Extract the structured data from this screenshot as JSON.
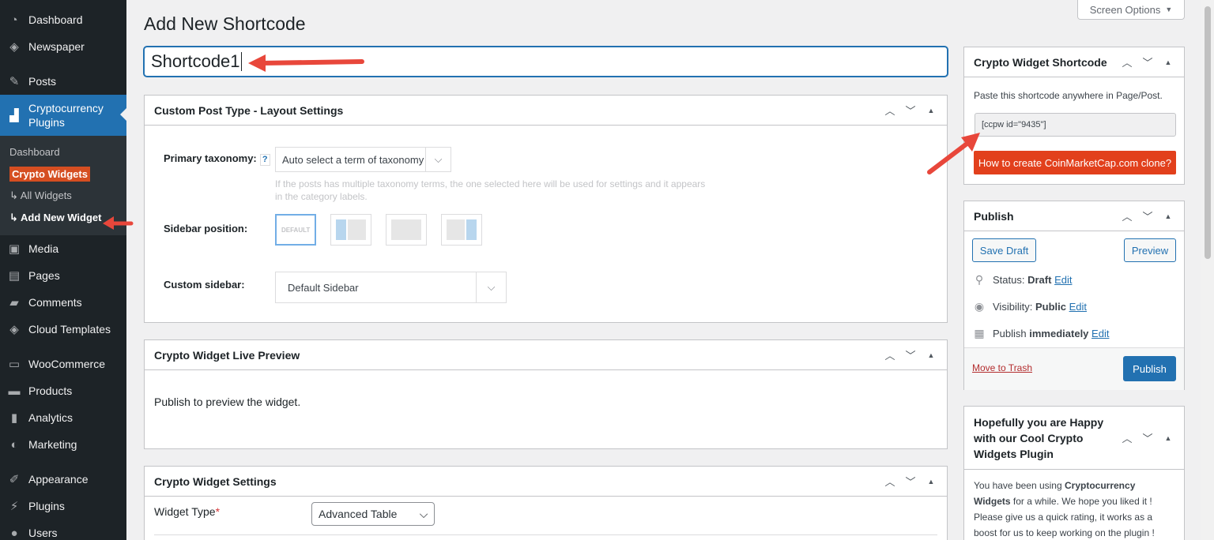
{
  "sidebar": {
    "items_top": [
      {
        "icon": "dashboard-icon",
        "glyph": "◔",
        "label": "Dashboard"
      },
      {
        "icon": "newspaper-icon",
        "glyph": "◈",
        "label": "Newspaper"
      }
    ],
    "items_mid": [
      {
        "icon": "pin-icon",
        "glyph": "✎",
        "label": "Posts"
      }
    ],
    "active": {
      "icon": "chart-icon",
      "glyph": "▟",
      "label_line1": "Cryptocurrency",
      "label_line2": "Plugins"
    },
    "sub": {
      "dashboard": "Dashboard",
      "crypto_widgets": "Crypto Widgets",
      "all_widgets": "↳ All Widgets",
      "add_new_widget": "↳ Add New Widget"
    },
    "items_after": [
      {
        "icon": "media-icon",
        "glyph": "▣",
        "label": "Media"
      },
      {
        "icon": "pages-icon",
        "glyph": "▤",
        "label": "Pages"
      },
      {
        "icon": "comments-icon",
        "glyph": "▰",
        "label": "Comments"
      },
      {
        "icon": "cloud-templates-icon",
        "glyph": "◈",
        "label": "Cloud Templates"
      }
    ],
    "items_woo": [
      {
        "icon": "woocommerce-icon",
        "glyph": "▭",
        "label": "WooCommerce"
      },
      {
        "icon": "products-icon",
        "glyph": "▬",
        "label": "Products"
      },
      {
        "icon": "analytics-icon",
        "glyph": "▮",
        "label": "Analytics"
      },
      {
        "icon": "marketing-icon",
        "glyph": "◐",
        "label": "Marketing"
      }
    ],
    "items_bottom": [
      {
        "icon": "appearance-icon",
        "glyph": "✐",
        "label": "Appearance"
      },
      {
        "icon": "plugins-icon",
        "glyph": "⚡",
        "label": "Plugins"
      },
      {
        "icon": "users-icon",
        "glyph": "●",
        "label": "Users"
      }
    ]
  },
  "screen_options": "Screen Options",
  "page_title": "Add New Shortcode",
  "title_value": "Shortcode1",
  "layout_box": {
    "title": "Custom Post Type - Layout Settings",
    "primary_taxonomy_label": "Primary taxonomy:",
    "help": "?",
    "primary_taxonomy_value": "Auto select a term of taxonomy",
    "hint_line1": "If the posts has multiple taxonomy terms, the one selected here will be used for settings and it appears",
    "hint_line2": "in the category labels.",
    "sidebar_position_label": "Sidebar position:",
    "default_label": "DEFAULT",
    "custom_sidebar_label": "Custom sidebar:",
    "custom_sidebar_value": "Default Sidebar"
  },
  "preview_box": {
    "title": "Crypto Widget Live Preview",
    "message": "Publish to preview the widget."
  },
  "settings_box": {
    "title": "Crypto Widget Settings",
    "widget_type_label": "Widget Type",
    "required": "*",
    "widget_type_value": "Advanced Table"
  },
  "shortcode_box": {
    "title": "Crypto Widget Shortcode",
    "instruction": "Paste this shortcode anywhere in Page/Post.",
    "shortcode": "[ccpw id=\"9435\"]",
    "cta": "How to create CoinMarketCap.com clone?",
    "cta_color": "#e2401c"
  },
  "publish_box": {
    "title": "Publish",
    "save_draft": "Save Draft",
    "preview": "Preview",
    "status_label": "Status:",
    "status_value": "Draft",
    "visibility_label": "Visibility:",
    "visibility_value": "Public",
    "publish_label": "Publish",
    "publish_value": "immediately",
    "edit": "Edit",
    "move_to_trash": "Move to Trash",
    "publish_button": "Publish"
  },
  "happy_box": {
    "title_line1": "Hopefully you are Happy",
    "title_line2": "with our Cool Crypto",
    "title_line3": "Widgets Plugin",
    "text_1": "You have been using ",
    "text_bold1": "Cryptocurrency",
    "text_bold2": "Widgets",
    "text_2": " for a while. We hope you liked it !",
    "text_3": "Please give us a quick rating, it works as a",
    "text_4": "boost for us to keep working on the plugin !"
  },
  "colors": {
    "accent": "#2271b1",
    "sidebar_bg": "#1d2327",
    "annotation_arrow": "#e8473b"
  }
}
